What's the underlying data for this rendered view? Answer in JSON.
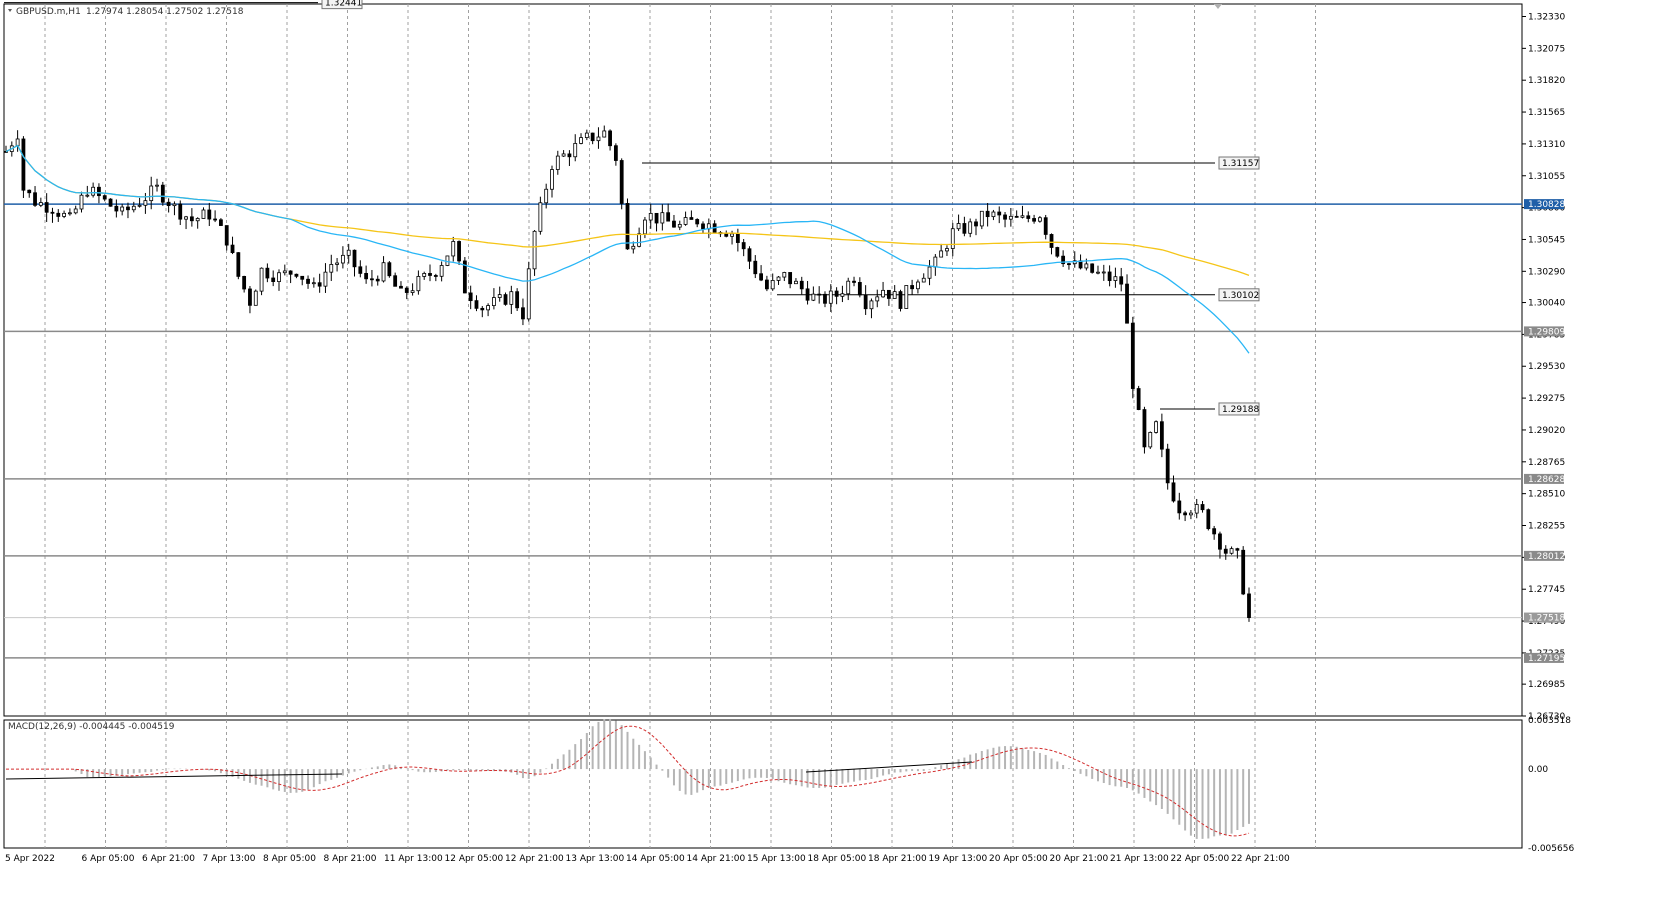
{
  "header": {
    "symbol": "GBPUSD.m,H1",
    "ohlc": "1.27974 1.28054 1.27502 1.27518"
  },
  "macd_header": {
    "label": "MACD(12,26,9) -0.004445 -0.004519"
  },
  "colors": {
    "background": "#ffffff",
    "grid": "#a0a0a0",
    "candle": "#000000",
    "ma_fast": "#29b6f6",
    "ma_slow": "#f5c518",
    "resistance_line": "#1f5fa8",
    "support_line": "#8a8a8a",
    "macd_hist": "#b5b5b5",
    "macd_signal": "#d32f2f"
  },
  "chart_data": [
    {
      "type": "candlestick",
      "symbol": "GBPUSD.m",
      "timeframe": "H1",
      "x_ticks": [
        "5 Apr 2022",
        "6 Apr 05:00",
        "6 Apr 21:00",
        "7 Apr 13:00",
        "8 Apr 05:00",
        "8 Apr 21:00",
        "11 Apr 13:00",
        "12 Apr 05:00",
        "12 Apr 21:00",
        "13 Apr 13:00",
        "14 Apr 05:00",
        "14 Apr 21:00",
        "15 Apr 13:00",
        "18 Apr 05:00",
        "18 Apr 21:00",
        "19 Apr 13:00",
        "20 Apr 05:00",
        "20 Apr 21:00",
        "21 Apr 13:00",
        "22 Apr 05:00",
        "22 Apr 21:00"
      ],
      "y_ticks": [
        "1.32330",
        "1.32075",
        "1.31820",
        "1.31565",
        "1.31310",
        "1.31055",
        "1.30800",
        "1.30545",
        "1.30290",
        "1.30040",
        "1.29785",
        "1.29530",
        "1.29275",
        "1.29020",
        "1.28765",
        "1.28510",
        "1.28255",
        "1.28000",
        "1.27745",
        "1.27490",
        "1.27235",
        "1.26985",
        "1.26730"
      ],
      "ylim": [
        1.2673,
        1.3243
      ],
      "last_price": 1.27518,
      "approx_path": [
        [
          0,
          1.3125
        ],
        [
          2,
          1.314
        ],
        [
          3,
          1.3095
        ],
        [
          5,
          1.3085
        ],
        [
          8,
          1.308
        ],
        [
          11,
          1.307
        ],
        [
          14,
          1.3095
        ],
        [
          17,
          1.3085
        ],
        [
          20,
          1.3075
        ],
        [
          23,
          1.3085
        ],
        [
          26,
          1.3095
        ],
        [
          29,
          1.308
        ],
        [
          32,
          1.307
        ],
        [
          35,
          1.3075
        ],
        [
          38,
          1.3055
        ],
        [
          40,
          1.3025
        ],
        [
          42,
          1.3005
        ],
        [
          44,
          1.303
        ],
        [
          47,
          1.3025
        ],
        [
          50,
          1.303
        ],
        [
          53,
          1.3015
        ],
        [
          56,
          1.3035
        ],
        [
          59,
          1.304
        ],
        [
          62,
          1.302
        ],
        [
          65,
          1.303
        ],
        [
          68,
          1.301
        ],
        [
          71,
          1.302
        ],
        [
          74,
          1.303
        ],
        [
          77,
          1.305
        ],
        [
          79,
          1.3015
        ],
        [
          82,
          1.3
        ],
        [
          85,
          1.3005
        ],
        [
          87,
          1.301
        ],
        [
          89,
          1.2995
        ],
        [
          91,
          1.306
        ],
        [
          94,
          1.3115
        ],
        [
          97,
          1.3125
        ],
        [
          100,
          1.3135
        ],
        [
          103,
          1.314
        ],
        [
          105,
          1.312
        ],
        [
          107,
          1.3045
        ],
        [
          110,
          1.3075
        ],
        [
          113,
          1.307
        ],
        [
          116,
          1.3065
        ],
        [
          119,
          1.307
        ],
        [
          122,
          1.3065
        ],
        [
          125,
          1.306
        ],
        [
          127,
          1.3045
        ],
        [
          129,
          1.303
        ],
        [
          131,
          1.3015
        ],
        [
          134,
          1.3025
        ],
        [
          137,
          1.3015
        ],
        [
          140,
          1.3005
        ],
        [
          143,
          1.301
        ],
        [
          146,
          1.3025
        ],
        [
          148,
          1.3005
        ],
        [
          151,
          1.3015
        ],
        [
          154,
          1.3005
        ],
        [
          157,
          1.3025
        ],
        [
          160,
          1.3035
        ],
        [
          163,
          1.306
        ],
        [
          166,
          1.3065
        ],
        [
          169,
          1.3075
        ],
        [
          172,
          1.307
        ],
        [
          175,
          1.307
        ],
        [
          178,
          1.3075
        ],
        [
          180,
          1.305
        ],
        [
          183,
          1.3035
        ],
        [
          186,
          1.303
        ],
        [
          189,
          1.3025
        ],
        [
          192,
          1.302
        ],
        [
          193,
          1.2985
        ],
        [
          194,
          1.294
        ],
        [
          196,
          1.2885
        ],
        [
          198,
          1.2905
        ],
        [
          200,
          1.286
        ],
        [
          202,
          1.284
        ],
        [
          204,
          1.284
        ],
        [
          206,
          1.2835
        ],
        [
          208,
          1.282
        ],
        [
          210,
          1.2805
        ],
        [
          212,
          1.28
        ],
        [
          214,
          1.27518
        ]
      ],
      "levels": [
        {
          "label": "1.32441",
          "value": 1.32441
        },
        {
          "label": "1.31157",
          "value": 1.31157
        },
        {
          "label": "1.30828",
          "value": 1.30828
        },
        {
          "label": "1.30102",
          "value": 1.30102
        },
        {
          "label": "1.29809",
          "value": 1.29809
        },
        {
          "label": "1.29188",
          "value": 1.29188
        },
        {
          "label": "1.28628",
          "value": 1.28628
        },
        {
          "label": "1.28012",
          "value": 1.28012
        },
        {
          "label": "1.27518",
          "value": 1.27518
        },
        {
          "label": "1.27195",
          "value": 1.27195
        }
      ]
    },
    {
      "type": "bar",
      "name": "MACD(12,26,9)",
      "y_ticks": [
        "0.003518",
        "0.00",
        "-0.005656"
      ],
      "ylim": [
        -0.005656,
        0.003518
      ],
      "main_value": -0.004445,
      "signal_value": -0.004519
    }
  ]
}
